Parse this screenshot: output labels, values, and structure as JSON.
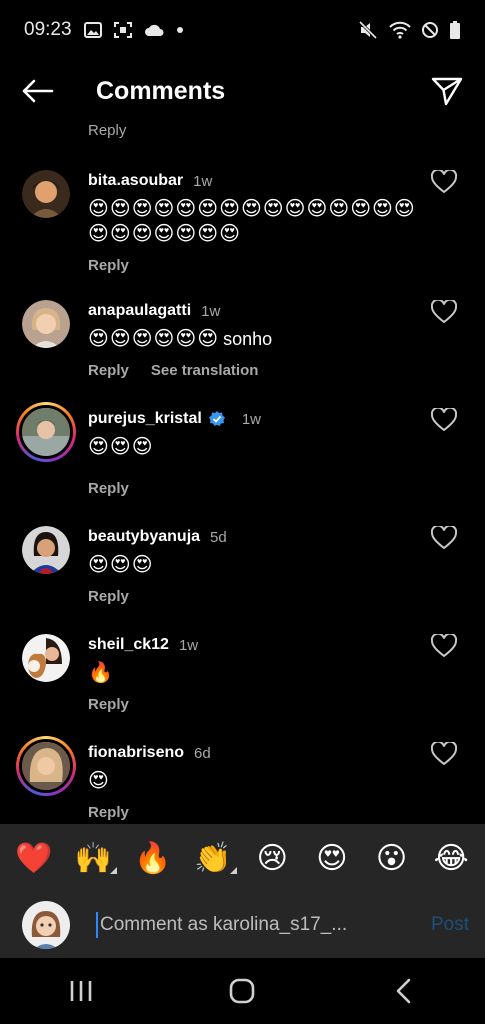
{
  "status_bar": {
    "time": "09:23",
    "left_icons": [
      "image-icon",
      "screenshot-icon",
      "cloud-icon",
      "dot-icon"
    ],
    "right_icons": [
      "mute-icon",
      "wifi-icon",
      "blocked-icon",
      "battery-icon"
    ]
  },
  "header": {
    "title": "Comments",
    "back_icon": "back-arrow-icon",
    "share_icon": "send-icon"
  },
  "partial_reply": "Reply",
  "comments": [
    {
      "username": "bita.asoubar",
      "time": "1w",
      "text": "😍😍😍😍😍😍😍😍😍😍😍😍😍😍😍😍😍😍😍😍😍😍",
      "reply_label": "Reply",
      "verified": false,
      "story_ring": false,
      "avatar_color": "#7a5a3c"
    },
    {
      "username": "anapaulagatti",
      "time": "1w",
      "text": "😍😍😍😍😍😍",
      "text_word": "sonho",
      "reply_label": "Reply",
      "translation_label": "See translation",
      "verified": false,
      "story_ring": false,
      "avatar_color": "#c9a98a"
    },
    {
      "username": "purejus_kristal",
      "time": "1w",
      "text": "😍😍😍",
      "reply_label": "Reply",
      "verified": true,
      "story_ring": true,
      "avatar_color": "#8a8f7a"
    },
    {
      "username": "beautybyanuja",
      "time": "5d",
      "text": "😍😍😍",
      "reply_label": "Reply",
      "verified": false,
      "story_ring": false,
      "avatar_color": "#7b2a2a"
    },
    {
      "username": "sheil_ck12",
      "time": "1w",
      "text": "🔥",
      "reply_label": "Reply",
      "verified": false,
      "story_ring": false,
      "avatar_color": "#b48a6a"
    },
    {
      "username": "fionabriseno",
      "time": "6d",
      "text": "😍",
      "reply_label": "Reply",
      "verified": false,
      "story_ring": true,
      "avatar_color": "#c8a27a"
    }
  ],
  "reactions": [
    {
      "emoji": "❤️",
      "name": "heart-reaction",
      "has_more": false
    },
    {
      "emoji": "🙌",
      "name": "raising-hands-reaction",
      "has_more": true
    },
    {
      "emoji": "🔥",
      "name": "fire-reaction",
      "has_more": false
    },
    {
      "emoji": "👏",
      "name": "clapping-reaction",
      "has_more": true
    },
    {
      "emoji": "😢",
      "name": "crying-reaction",
      "has_more": false
    },
    {
      "emoji": "😍",
      "name": "heart-eyes-reaction",
      "has_more": false
    },
    {
      "emoji": "😮",
      "name": "surprised-reaction",
      "has_more": false
    },
    {
      "emoji": "😂",
      "name": "laughing-reaction",
      "has_more": false
    }
  ],
  "composer": {
    "placeholder": "Comment as karolina_s17_...",
    "post_label": "Post"
  },
  "nav_bar": [
    "recents-icon",
    "home-icon",
    "back-icon"
  ],
  "colors": {
    "background": "#000000",
    "panel": "#262626",
    "secondary_text": "#a8a8a8",
    "post_disabled": "#1c4f7d",
    "verified_blue": "#3897f0"
  }
}
